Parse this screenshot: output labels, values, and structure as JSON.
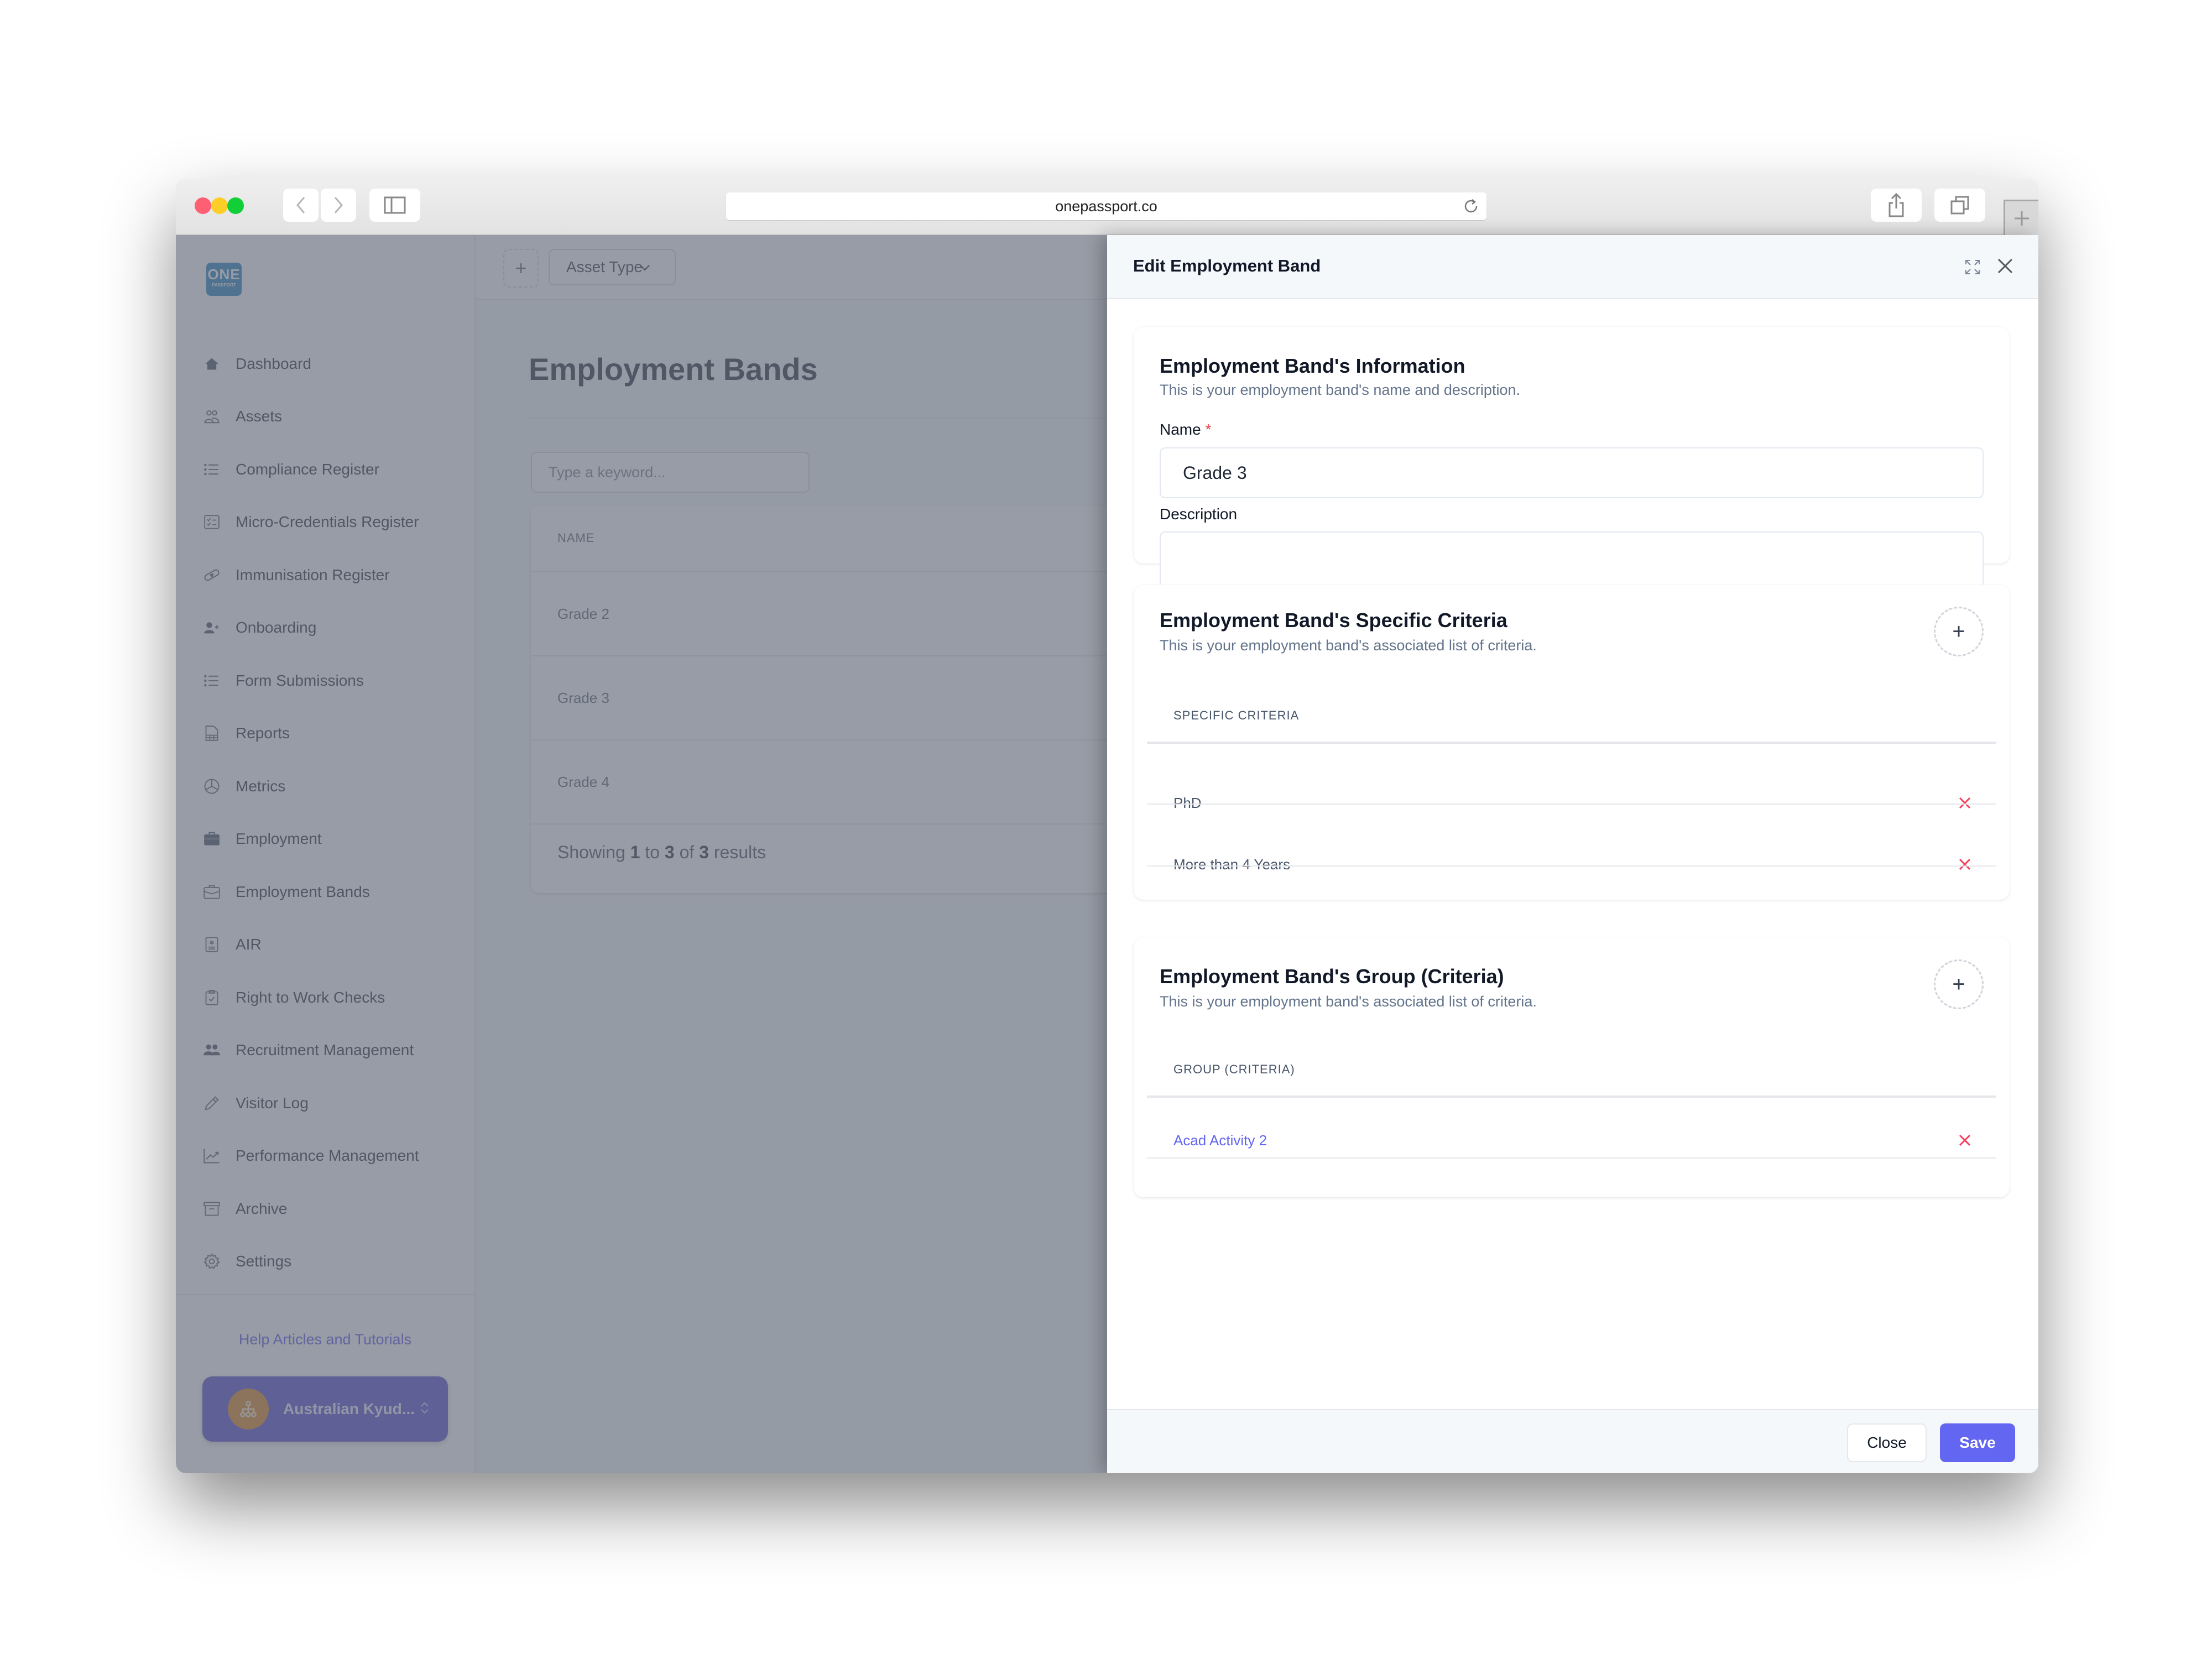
{
  "browser": {
    "url": "onepassport.co",
    "icons": [
      "back-icon",
      "forward-icon",
      "sidebar-toggle-icon",
      "reload-icon",
      "share-icon",
      "tabs-icon",
      "new-tab-icon"
    ]
  },
  "sidebar": {
    "logo_line1": "ONE",
    "logo_line2": "PASSPORT",
    "items": [
      {
        "label": "Dashboard",
        "icon": "home-icon"
      },
      {
        "label": "Assets",
        "icon": "users-icon"
      },
      {
        "label": "Compliance Register",
        "icon": "list-icon"
      },
      {
        "label": "Micro-Credentials Register",
        "icon": "checklist-icon"
      },
      {
        "label": "Immunisation Register",
        "icon": "bandage-icon"
      },
      {
        "label": "Onboarding",
        "icon": "user-plus-icon"
      },
      {
        "label": "Form Submissions",
        "icon": "list-icon"
      },
      {
        "label": "Reports",
        "icon": "report-icon"
      },
      {
        "label": "Metrics",
        "icon": "pie-chart-icon"
      },
      {
        "label": "Employment",
        "icon": "briefcase-filled-icon"
      },
      {
        "label": "Employment Bands",
        "icon": "briefcase-outline-icon"
      },
      {
        "label": "AIR",
        "icon": "medical-id-icon"
      },
      {
        "label": "Right to Work Checks",
        "icon": "clipboard-check-icon"
      },
      {
        "label": "Recruitment Management",
        "icon": "user-group-icon"
      },
      {
        "label": "Visitor Log",
        "icon": "pencil-icon"
      },
      {
        "label": "Performance Management",
        "icon": "trending-up-icon"
      },
      {
        "label": "Archive",
        "icon": "archive-icon"
      },
      {
        "label": "Settings",
        "icon": "gear-icon"
      }
    ],
    "help_link": "Help Articles and Tutorials",
    "org_name": "Australian Kyud..."
  },
  "topbar": {
    "add_label": "+",
    "asset_type_label": "Asset Type"
  },
  "main": {
    "title": "Employment Bands",
    "search_placeholder": "Type a keyword...",
    "table_header": "NAME",
    "rows": [
      "Grade 2",
      "Grade 3",
      "Grade 4"
    ],
    "showing_prefix": "Showing",
    "showing_from": "1",
    "showing_to_word": "to",
    "showing_to": "3",
    "showing_of_word": "of",
    "showing_total": "3",
    "showing_suffix": "results"
  },
  "panel": {
    "title": "Edit Employment Band",
    "info": {
      "title": "Employment Band's Information",
      "subtitle": "This is your employment band's name and description.",
      "name_label": "Name",
      "required_mark": "*",
      "name_value": "Grade 3",
      "description_label": "Description",
      "description_value": ""
    },
    "specific": {
      "title": "Employment Band's Specific Criteria",
      "subtitle": "This is your employment band's associated list of criteria.",
      "column": "SPECIFIC CRITERIA",
      "items": [
        "PhD",
        "More than 4 Years"
      ]
    },
    "group": {
      "title": "Employment Band's Group (Criteria)",
      "subtitle": "This is your employment band's associated list of criteria.",
      "column": "GROUP (CRITERIA)",
      "items": [
        "Acad Activity 2"
      ]
    },
    "close_label": "Close",
    "save_label": "Save"
  },
  "colors": {
    "accent": "#6366f1",
    "delete": "#f43f5e",
    "org_button": "#4338ca",
    "org_avatar": "#d97706",
    "logo": "#0e74b6"
  }
}
